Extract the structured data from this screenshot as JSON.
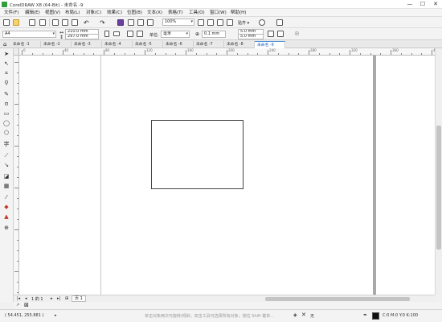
{
  "title_bar": {
    "title": "CorelDRAW X8 (64-Bit) - 未命名 -9",
    "minimize": "—",
    "maximize": "☐",
    "close": "✕"
  },
  "menu": [
    "文件(F)",
    "编辑(E)",
    "视图(V)",
    "布局(L)",
    "对象(C)",
    "效果(C)",
    "位图(B)",
    "文本(X)",
    "表格(T)",
    "工具(O)",
    "窗口(W)",
    "帮助(H)"
  ],
  "standard_toolbar": {
    "zoom_value": "100%",
    "snap_label": "贴齐"
  },
  "property_bar": {
    "page_size": "A4",
    "width": "210.0 mm",
    "height": "297.0 mm",
    "units_label": "单位:",
    "units_value": "毫米",
    "nudge": "0.1 mm",
    "dup_x": "5.0 mm",
    "dup_y": "5.0 mm"
  },
  "doc_tabs": [
    "未命名 -1",
    "未命名 -2",
    "未命名 -3",
    "未命名 -4",
    "未命名 -5",
    "未命名 -6",
    "未命名 -7",
    "未命名 -8",
    "未命名 -9"
  ],
  "active_tab_index": 8,
  "ruler_labels": [
    "0",
    "40",
    "80",
    "120",
    "160",
    "200",
    "240",
    "280",
    "320",
    "360",
    "400"
  ],
  "page_nav": {
    "page_count": "1 的 1",
    "page_tab": "页 1"
  },
  "status": {
    "coords": "( 54.451, 255.881 )",
    "hint": "单击对象两次可旋转/倾斜；双击工具可选择所有对象；按住 Shift 键单击可选择多个对象…",
    "fill_none": "无",
    "color_readout": "C:0 M:0 Y:0 K:100"
  },
  "colors": {
    "accent": "#4a90d9",
    "app_green": "#2e9e3f"
  }
}
